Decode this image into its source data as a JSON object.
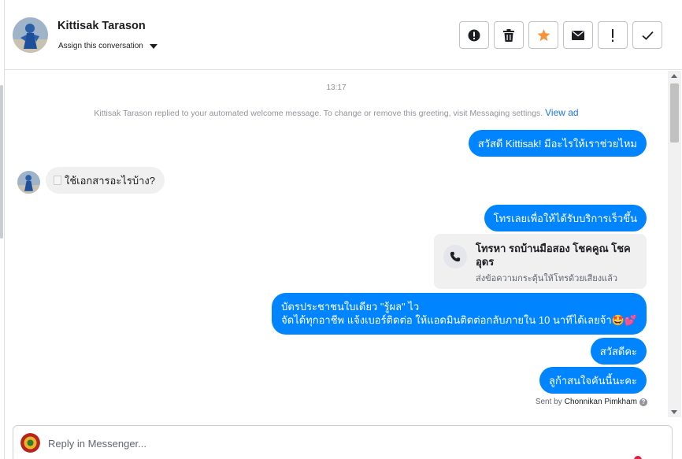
{
  "header": {
    "contact_name": "Kittisak Tarason",
    "assign_label": "Assign this conversation"
  },
  "toolbar": {
    "buttons": [
      {
        "icon": "alert-icon"
      },
      {
        "icon": "trash-icon"
      },
      {
        "icon": "star-icon",
        "color": "#f7923b"
      },
      {
        "icon": "envelope-icon"
      },
      {
        "icon": "exclamation-icon"
      },
      {
        "icon": "check-icon"
      }
    ]
  },
  "conversation": {
    "timestamp": "13:17",
    "system_message": "Kittisak Tarason replied to your automated welcome message. To change or remove this greeting, visit Messaging settings.",
    "system_link": "View ad",
    "messages": [
      {
        "direction": "outgoing",
        "text": "สวัสดี Kittisak! มีอะไรให้เราช่วยไหม"
      },
      {
        "direction": "incoming",
        "text": "ใช้เอกสารอะไรบ้าง?"
      },
      {
        "direction": "outgoing",
        "text": "โทรเลยเพื่อให้ได้รับบริการเร็วขึ้น"
      },
      {
        "direction": "outgoing",
        "text_line1": "บัตรประชาชนใบเดียว \"รู้ผล\" ไว",
        "text_line2": "จัดได้ทุกอาชีพ แจ้งเบอร์ติดต่อ ให้แอดมินติดต่อกลับภายใน 10 นาทีได้เลยจ้า🤩💕"
      },
      {
        "direction": "outgoing",
        "text": "สวัสดีคะ"
      },
      {
        "direction": "outgoing",
        "text": "ลูก้าสนใจคันนี้นะคะ"
      }
    ],
    "call_card": {
      "icon": "phone-icon",
      "title": "โทรหา รถบ้านมือสอง โชคคูณ โชคอุดร",
      "subtitle": "ส่งข้อความกระตุ้นให้โทรด้วยเสียงแล้ว"
    },
    "sent_by_prefix": "Sent by",
    "sent_by_name": "Chonnikan Pimkham"
  },
  "composer": {
    "placeholder": "Reply in Messenger..."
  },
  "colors": {
    "accent": "#0084ff",
    "link": "#1877f2",
    "bubble_in": "#f0f0f0"
  }
}
